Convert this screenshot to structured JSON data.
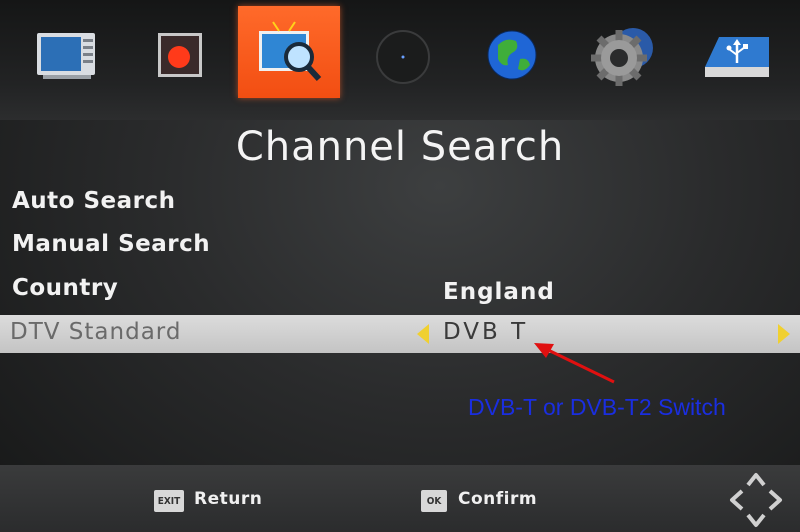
{
  "top_menu": {
    "icons": [
      {
        "name": "picture-settings-icon"
      },
      {
        "name": "record-icon"
      },
      {
        "name": "channel-search-icon",
        "selected": true
      },
      {
        "name": "blank-circle-icon"
      },
      {
        "name": "globe-icon"
      },
      {
        "name": "system-gear-icon"
      },
      {
        "name": "usb-icon"
      }
    ]
  },
  "page": {
    "title": "Channel Search"
  },
  "menu": {
    "auto_search": "Auto Search",
    "manual_search": "Manual Search",
    "country_label": "Country",
    "country_value": "England",
    "dtv_label": "DTV Standard",
    "dtv_value": "DVB T"
  },
  "annotation": {
    "text": "DVB-T or DVB-T2 Switch",
    "color": "#1a2ee0"
  },
  "footer": {
    "exit_key": "EXIT",
    "return_label": "Return",
    "ok_key": "OK",
    "confirm_label": "Confirm"
  },
  "colors": {
    "accent": "#f24e12",
    "highlight_arrow": "#f0d030",
    "annotation_arrow": "#e01010"
  }
}
